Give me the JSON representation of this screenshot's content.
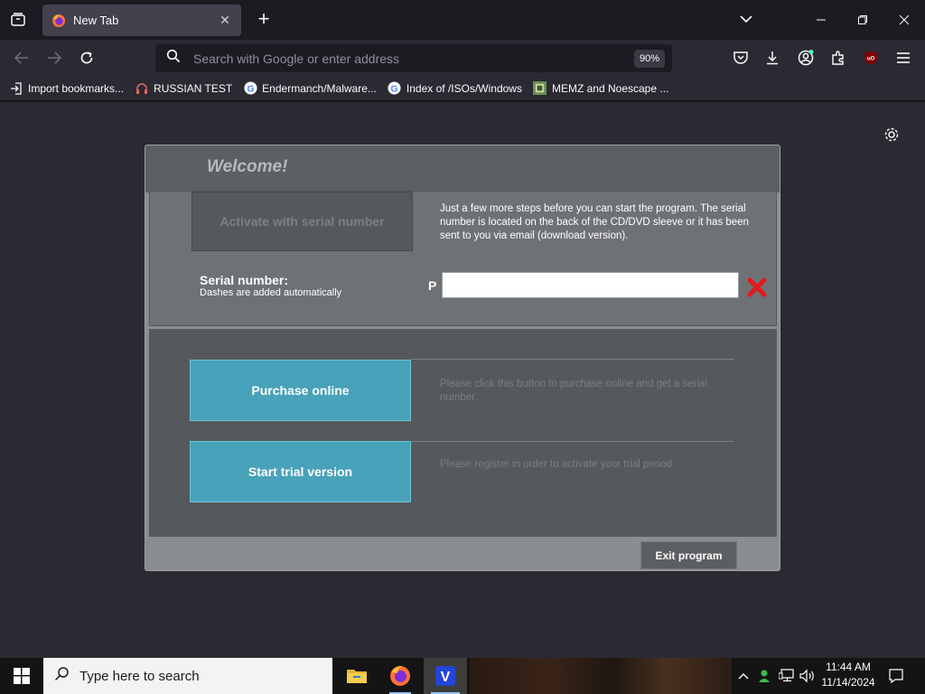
{
  "browser": {
    "tab_title": "New Tab",
    "url_placeholder": "Search with Google or enter address",
    "zoom": "90%",
    "bookmarks": [
      "Import bookmarks...",
      "RUSSIAN TEST",
      "Endermanch/Malware...",
      "Index of /ISOs/Windows",
      "MEMZ and Noescape ..."
    ]
  },
  "dialog": {
    "welcome": "Welcome!",
    "serial_tab_label": "Activate with serial number",
    "serial_info": "Just a few more steps before you can start the program. The serial number is located on the back of the CD/DVD sleeve or it has been sent to you via email (download version).",
    "serial_label": "Serial number:",
    "serial_hint": "Dashes are added automatically",
    "serial_prefix": "P",
    "serial_value": "",
    "purchase_label": "Purchase online",
    "purchase_desc": "Please click this button to purchase online and get a serial number.",
    "trial_label": "Start trial version",
    "trial_desc": "Please register in order to activate your trial period.",
    "exit_label": "Exit program"
  },
  "taskbar": {
    "search_placeholder": "Type here to search",
    "time": "11:44 AM",
    "date": "11/14/2024"
  },
  "colors": {
    "accent_button": "#48a2b9",
    "browser_bg": "#2b2a33"
  }
}
